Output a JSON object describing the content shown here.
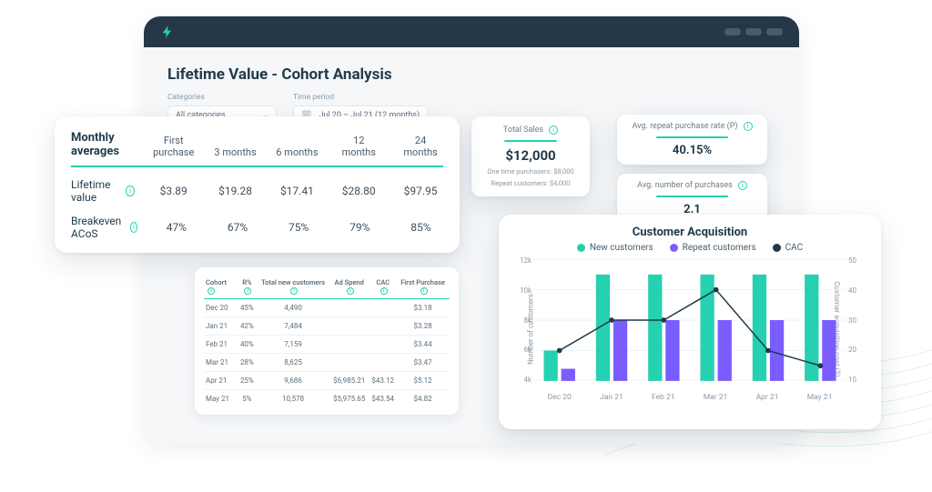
{
  "page": {
    "title": "Lifetime Value - Cohort Analysis"
  },
  "filters": {
    "categories_label": "Categories",
    "categories_value": "All categories",
    "period_label": "Time period",
    "period_value": "Jul 20 – Jul 21 (12 months)"
  },
  "kpi_total_sales": {
    "title": "Total Sales",
    "value": "$12,000",
    "sub1": "One time purchasers: $8,000",
    "sub2": "Repeat customers: $4,000"
  },
  "kpi_repeat_rate": {
    "title": "Avg. repeat purchase rate (P)",
    "value": "40.15%"
  },
  "kpi_num_purchases": {
    "title": "Avg. number of purchases",
    "value": "2.1"
  },
  "averages": {
    "heading": "Monthly averages",
    "cols": [
      "First purchase",
      "3 months",
      "6 months",
      "12 months",
      "24 months"
    ],
    "rows": [
      {
        "label": "Lifetime value",
        "info": true,
        "cells": [
          "$3.89",
          "$19.28",
          "$17.41",
          "$28.80",
          "$97.95"
        ]
      },
      {
        "label": "Breakeven ACoS",
        "info": true,
        "cells": [
          "47%",
          "67%",
          "75%",
          "79%",
          "85%"
        ]
      }
    ]
  },
  "cohort_table": {
    "headers": [
      "Cohort",
      "R%",
      "Total new customers",
      "Ad Spend",
      "CAC",
      "First Purchase"
    ],
    "rows": [
      {
        "cohort": "Dec 20",
        "r": "45%",
        "tnc": "4,490",
        "ad": "",
        "cac": "",
        "fp": "$3.18"
      },
      {
        "cohort": "Jan 21",
        "r": "42%",
        "tnc": "7,484",
        "ad": "",
        "cac": "",
        "fp": "$3.28"
      },
      {
        "cohort": "Feb 21",
        "r": "40%",
        "tnc": "7,159",
        "ad": "",
        "cac": "",
        "fp": "$3.44"
      },
      {
        "cohort": "Mar 21",
        "r": "28%",
        "tnc": "8,625",
        "ad": "",
        "cac": "",
        "fp": "$3.47"
      },
      {
        "cohort": "Apr 21",
        "r": "25%",
        "tnc": "9,686",
        "ad": "$6,985.21",
        "cac": "$43.12",
        "fp": "$5.12"
      },
      {
        "cohort": "May 21",
        "r": "5%",
        "tnc": "10,578",
        "ad": "$5,975.65",
        "cac": "$43.54",
        "fp": "$4.82"
      }
    ]
  },
  "chart": {
    "title": "Customer Acquisition",
    "legend": {
      "new": "New customers",
      "repeat": "Repeat customers",
      "cac": "CAC"
    },
    "ylabel": "Number of customers",
    "ylabel2": "Customer acquisition cost ($)",
    "yticks": [
      "12k",
      "10k",
      "8k",
      "6k",
      "4k"
    ],
    "yticks2": [
      "50",
      "40",
      "30",
      "20",
      "10"
    ]
  },
  "chart_data": {
    "type": "bar",
    "categories": [
      "Dec 20",
      "Jan 21",
      "Feb 21",
      "Mar 21",
      "Apr 21",
      "May 21"
    ],
    "series": [
      {
        "name": "New customers",
        "axis": "left",
        "values": [
          6000,
          11000,
          11000,
          11000,
          11000,
          11000
        ]
      },
      {
        "name": "Repeat customers",
        "axis": "left",
        "values": [
          4800,
          8000,
          8000,
          8000,
          8000,
          8000
        ]
      },
      {
        "name": "CAC",
        "axis": "right",
        "type": "line",
        "values": [
          20,
          30,
          30,
          40,
          20,
          15
        ]
      }
    ],
    "ylabel": "Number of customers",
    "ylabel2": "Customer acquisition cost ($)",
    "ylim_left": [
      4000,
      12000
    ],
    "ylim_right": [
      10,
      50
    ]
  }
}
